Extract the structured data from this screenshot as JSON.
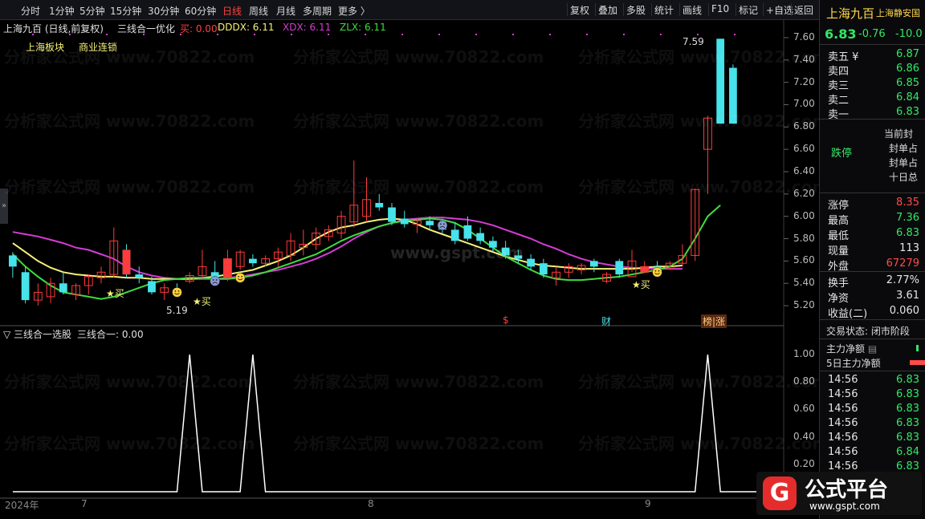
{
  "toolbar": {
    "periods": [
      "分时",
      "1分钟",
      "5分钟",
      "15分钟",
      "30分钟",
      "60分钟",
      "日线",
      "周线",
      "月线",
      "多周期",
      "更多 〉"
    ],
    "active_period": "日线",
    "buttons": [
      "复权",
      "叠加",
      "多股",
      "统计",
      "画线",
      "F10",
      "标记",
      "+自选",
      "返回"
    ]
  },
  "chart_header": {
    "stock": "上海九百 (日线,前复权)",
    "indicator": "三线合一优化",
    "buy": "买: 0.00",
    "dddx": "DDDX: 6.11",
    "xdx": "XDX: 6.11",
    "zlx": "ZLX: 6.11",
    "tag1": "上海板块",
    "tag2": "商业连锁",
    "high_mark": "7.59",
    "low_mark": "5.19",
    "buy_label": "★买",
    "event1": "$",
    "event2": "财",
    "event3": "榜|涨"
  },
  "price_axis": [
    "7.60",
    "7.40",
    "7.20",
    "7.00",
    "6.80",
    "6.60",
    "6.40",
    "6.20",
    "6.00",
    "5.80",
    "5.60",
    "5.40",
    "5.20"
  ],
  "sub_header": {
    "name": "三线合一选股",
    "value": "三线合一: 0.00"
  },
  "sub_axis": [
    "1.00",
    "0.80",
    "0.60",
    "0.40",
    "0.20"
  ],
  "time_axis": [
    "2024年",
    "7",
    "8",
    "9"
  ],
  "watermark": "分析家公式网 www.70822.com",
  "watermark_center": "www.gspt.com",
  "side": {
    "title": "上海九百",
    "market": "上海静安国",
    "price": "6.83",
    "change": "-0.76",
    "pct": "-10.0",
    "asks": [
      {
        "label": "卖五 ¥",
        "value": "6.87"
      },
      {
        "label": "卖四",
        "value": "6.86"
      },
      {
        "label": "卖三",
        "value": "6.85"
      },
      {
        "label": "卖二",
        "value": "6.84"
      },
      {
        "label": "卖一",
        "value": "6.83"
      }
    ],
    "status": "跌停",
    "limit_notes": [
      "当前封",
      "封单占",
      "封单占",
      "十日总"
    ],
    "stats": [
      {
        "label": "涨停",
        "value": "8.35",
        "color": "#ff4b4b"
      },
      {
        "label": "最高",
        "value": "7.36",
        "color": "#33e666"
      },
      {
        "label": "最低",
        "value": "6.83",
        "color": "#33e666"
      },
      {
        "label": "现量",
        "value": "113",
        "color": "#e6e6e6"
      },
      {
        "label": "外盘",
        "value": "67279",
        "color": "#ff4b4b"
      }
    ],
    "stats2": [
      {
        "label": "换手",
        "value": "2.77%"
      },
      {
        "label": "净资",
        "value": "3.61"
      },
      {
        "label": "收益(二)",
        "value": "0.060"
      }
    ],
    "trade_status": "交易状态: 闭市阶段",
    "flow1": "主力净额",
    "flow2": "5日主力净额",
    "ticks": [
      {
        "time": "14:56",
        "price": "6.83"
      },
      {
        "time": "14:56",
        "price": "6.83"
      },
      {
        "time": "14:56",
        "price": "6.83"
      },
      {
        "time": "14:56",
        "price": "6.83"
      },
      {
        "time": "14:56",
        "price": "6.83"
      },
      {
        "time": "14:56",
        "price": "6.84"
      },
      {
        "time": "14:56",
        "price": "6.83"
      }
    ]
  },
  "brand": {
    "name": "公式平台",
    "url": "www.gspt.com"
  },
  "colors": {
    "up": "#ff3b3b",
    "down": "#46e3ea",
    "ma_pink": "#d63cd6",
    "ma_yellow": "#f5f17a",
    "ma_green": "#3edc3e"
  },
  "chart_data": {
    "type": "candlestick",
    "ylim": [
      5.1,
      7.7
    ],
    "candles": [
      {
        "o": 5.55,
        "h": 5.68,
        "l": 5.45,
        "c": 5.65,
        "u": false
      },
      {
        "o": 5.5,
        "h": 5.55,
        "l": 5.22,
        "c": 5.25,
        "u": false
      },
      {
        "o": 5.25,
        "h": 5.4,
        "l": 5.2,
        "c": 5.32,
        "u": true
      },
      {
        "o": 5.28,
        "h": 5.45,
        "l": 5.22,
        "c": 5.4,
        "u": true
      },
      {
        "o": 5.4,
        "h": 5.5,
        "l": 5.3,
        "c": 5.32,
        "u": false
      },
      {
        "o": 5.3,
        "h": 5.4,
        "l": 5.25,
        "c": 5.38,
        "u": true
      },
      {
        "o": 5.38,
        "h": 5.48,
        "l": 5.3,
        "c": 5.46,
        "u": true
      },
      {
        "o": 5.45,
        "h": 5.55,
        "l": 5.4,
        "c": 5.5,
        "u": true
      },
      {
        "o": 5.48,
        "h": 5.9,
        "l": 5.45,
        "c": 5.78,
        "u": true
      },
      {
        "o": 5.7,
        "h": 5.75,
        "l": 5.45,
        "c": 5.48,
        "u": false
      },
      {
        "o": 5.48,
        "h": 5.55,
        "l": 5.4,
        "c": 5.45,
        "u": false
      },
      {
        "o": 5.42,
        "h": 5.46,
        "l": 5.3,
        "c": 5.32,
        "u": false
      },
      {
        "o": 5.32,
        "h": 5.4,
        "l": 5.25,
        "c": 5.36,
        "u": true
      },
      {
        "o": 5.35,
        "h": 5.4,
        "l": 5.28,
        "c": 5.3,
        "u": false
      },
      {
        "o": 5.42,
        "h": 5.5,
        "l": 5.4,
        "c": 5.47,
        "u": true
      },
      {
        "o": 5.47,
        "h": 5.7,
        "l": 5.45,
        "c": 5.55,
        "u": true
      },
      {
        "o": 5.5,
        "h": 5.6,
        "l": 5.42,
        "c": 5.45,
        "u": false
      },
      {
        "o": 5.45,
        "h": 5.7,
        "l": 5.42,
        "c": 5.62,
        "u": true
      },
      {
        "o": 5.55,
        "h": 5.7,
        "l": 5.52,
        "c": 5.68,
        "u": true
      },
      {
        "o": 5.62,
        "h": 5.66,
        "l": 5.55,
        "c": 5.58,
        "u": false
      },
      {
        "o": 5.58,
        "h": 5.65,
        "l": 5.55,
        "c": 5.62,
        "u": true
      },
      {
        "o": 5.62,
        "h": 5.72,
        "l": 5.55,
        "c": 5.68,
        "u": true
      },
      {
        "o": 5.65,
        "h": 5.85,
        "l": 5.6,
        "c": 5.78,
        "u": true
      },
      {
        "o": 5.72,
        "h": 5.88,
        "l": 5.65,
        "c": 5.75,
        "u": true
      },
      {
        "o": 5.75,
        "h": 5.9,
        "l": 5.7,
        "c": 5.85,
        "u": true
      },
      {
        "o": 5.82,
        "h": 5.92,
        "l": 5.78,
        "c": 5.88,
        "u": true
      },
      {
        "o": 5.85,
        "h": 6.05,
        "l": 5.8,
        "c": 6.0,
        "u": true
      },
      {
        "o": 5.95,
        "h": 6.5,
        "l": 5.9,
        "c": 6.1,
        "u": true
      },
      {
        "o": 6.0,
        "h": 6.35,
        "l": 5.95,
        "c": 6.15,
        "u": true
      },
      {
        "o": 6.12,
        "h": 6.2,
        "l": 6.05,
        "c": 6.08,
        "u": false
      },
      {
        "o": 6.08,
        "h": 6.12,
        "l": 5.92,
        "c": 5.95,
        "u": false
      },
      {
        "o": 5.98,
        "h": 6.05,
        "l": 5.9,
        "c": 5.93,
        "u": false
      },
      {
        "o": 5.93,
        "h": 5.98,
        "l": 5.85,
        "c": 5.96,
        "u": true
      },
      {
        "o": 5.96,
        "h": 6.0,
        "l": 5.88,
        "c": 5.92,
        "u": false
      },
      {
        "o": 5.92,
        "h": 5.98,
        "l": 5.85,
        "c": 5.88,
        "u": false
      },
      {
        "o": 5.88,
        "h": 5.95,
        "l": 5.75,
        "c": 5.78,
        "u": false
      },
      {
        "o": 5.92,
        "h": 6.0,
        "l": 5.78,
        "c": 5.8,
        "u": false
      },
      {
        "o": 5.85,
        "h": 5.9,
        "l": 5.75,
        "c": 5.78,
        "u": false
      },
      {
        "o": 5.78,
        "h": 5.82,
        "l": 5.68,
        "c": 5.72,
        "u": false
      },
      {
        "o": 5.72,
        "h": 5.78,
        "l": 5.62,
        "c": 5.65,
        "u": false
      },
      {
        "o": 5.65,
        "h": 5.7,
        "l": 5.58,
        "c": 5.62,
        "u": false
      },
      {
        "o": 5.62,
        "h": 5.66,
        "l": 5.52,
        "c": 5.55,
        "u": false
      },
      {
        "o": 5.58,
        "h": 5.62,
        "l": 5.45,
        "c": 5.48,
        "u": false
      },
      {
        "o": 5.5,
        "h": 5.55,
        "l": 5.38,
        "c": 5.45,
        "u": true
      },
      {
        "o": 5.5,
        "h": 5.58,
        "l": 5.45,
        "c": 5.55,
        "u": true
      },
      {
        "o": 5.52,
        "h": 5.58,
        "l": 5.48,
        "c": 5.56,
        "u": true
      },
      {
        "o": 5.55,
        "h": 5.62,
        "l": 5.5,
        "c": 5.6,
        "u": false
      },
      {
        "o": 5.42,
        "h": 5.5,
        "l": 5.4,
        "c": 5.48,
        "u": true
      },
      {
        "o": 5.48,
        "h": 5.62,
        "l": 5.45,
        "c": 5.6,
        "u": false
      },
      {
        "o": 5.6,
        "h": 5.7,
        "l": 5.5,
        "c": 5.46,
        "u": true
      },
      {
        "o": 5.5,
        "h": 5.6,
        "l": 5.5,
        "c": 5.55,
        "u": true
      },
      {
        "o": 5.55,
        "h": 5.6,
        "l": 5.5,
        "c": 5.53,
        "u": false
      },
      {
        "o": 5.53,
        "h": 5.6,
        "l": 5.52,
        "c": 5.58,
        "u": true
      },
      {
        "o": 5.58,
        "h": 5.75,
        "l": 5.55,
        "c": 5.65,
        "u": true
      },
      {
        "o": 5.65,
        "h": 6.25,
        "l": 5.6,
        "c": 6.24,
        "u": true
      },
      {
        "o": 6.6,
        "h": 6.9,
        "l": 6.2,
        "c": 6.88,
        "u": true
      },
      {
        "o": 7.59,
        "h": 7.59,
        "l": 6.83,
        "c": 6.83,
        "u": false
      },
      {
        "o": 7.33,
        "h": 7.36,
        "l": 6.83,
        "c": 6.83,
        "u": false
      }
    ],
    "ma_pink": [
      5.86,
      5.84,
      5.82,
      5.79,
      5.76,
      5.72,
      5.7,
      5.66,
      5.62,
      5.55,
      5.5,
      5.47,
      5.45,
      5.44,
      5.44,
      5.44,
      5.44,
      5.45,
      5.46,
      5.48,
      5.5,
      5.52,
      5.55,
      5.58,
      5.62,
      5.67,
      5.73,
      5.8,
      5.86,
      5.91,
      5.94,
      5.97,
      5.98,
      5.99,
      5.99,
      5.98,
      5.97,
      5.95,
      5.92,
      5.88,
      5.84,
      5.8,
      5.75,
      5.71,
      5.66,
      5.62,
      5.59,
      5.57,
      5.55,
      5.54,
      5.53,
      5.53,
      5.53,
      5.53
    ],
    "ma_yellow": [
      5.76,
      5.68,
      5.6,
      5.54,
      5.5,
      5.48,
      5.47,
      5.46,
      5.46,
      5.45,
      5.45,
      5.44,
      5.44,
      5.44,
      5.44,
      5.45,
      5.46,
      5.48,
      5.5,
      5.52,
      5.56,
      5.6,
      5.65,
      5.72,
      5.8,
      5.86,
      5.9,
      5.92,
      5.95,
      5.97,
      5.98,
      5.97,
      5.93,
      5.88,
      5.84,
      5.8,
      5.76,
      5.72,
      5.68,
      5.64,
      5.61,
      5.58,
      5.56,
      5.55,
      5.54,
      5.53,
      5.53,
      5.53,
      5.53,
      5.53,
      5.54,
      5.55,
      5.55,
      5.56
    ],
    "ma_green": [
      5.66,
      5.55,
      5.46,
      5.38,
      5.32,
      5.3,
      5.28,
      5.26,
      5.28,
      5.32,
      5.36,
      5.4,
      5.43,
      5.44,
      5.45,
      5.45,
      5.44,
      5.44,
      5.45,
      5.47,
      5.5,
      5.54,
      5.58,
      5.62,
      5.66,
      5.72,
      5.78,
      5.83,
      5.87,
      5.91,
      5.94,
      5.96,
      5.97,
      5.98,
      5.97,
      5.94,
      5.88,
      5.8,
      5.72,
      5.64,
      5.58,
      5.52,
      5.47,
      5.44,
      5.43,
      5.43,
      5.44,
      5.45,
      5.46,
      5.48,
      5.5,
      5.52,
      5.55,
      5.62,
      5.8,
      6.0,
      6.1
    ],
    "sub_signal": [
      0,
      0,
      0,
      0,
      0,
      0,
      0,
      0,
      0,
      0,
      0,
      0,
      0,
      0,
      1,
      0,
      0,
      0,
      0,
      1,
      0,
      0,
      0,
      0,
      0,
      0,
      0,
      0,
      0,
      0,
      0,
      0,
      0,
      0,
      0,
      0,
      0,
      0,
      0,
      0,
      0,
      0,
      0,
      0,
      0,
      0,
      0,
      0,
      0,
      0,
      0,
      0,
      0,
      0,
      0,
      1,
      0,
      0,
      0,
      0,
      0
    ],
    "sub_ylim": [
      0,
      1.1
    ]
  }
}
